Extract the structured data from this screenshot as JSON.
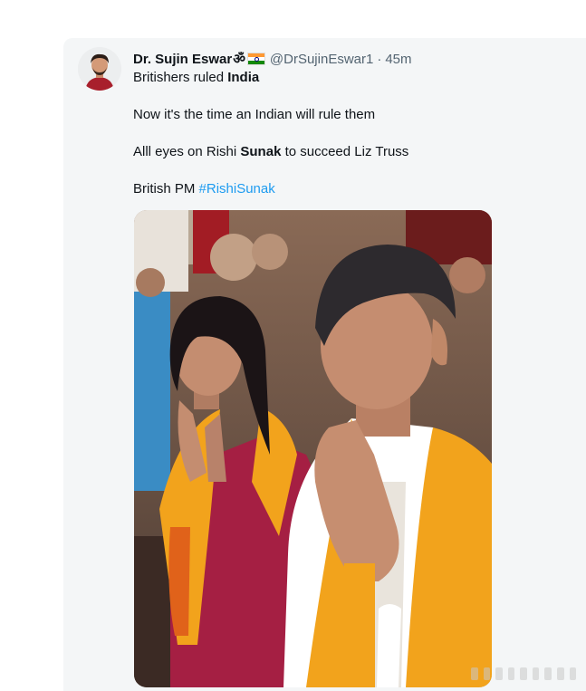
{
  "tweet": {
    "author": {
      "display_name": "Dr. Sujin Eswar",
      "om_symbol": "ॐ",
      "flag_icon": "india-flag-icon",
      "handle": "@DrSujinEswar1",
      "separator": "·",
      "time": "45m"
    },
    "lines": {
      "l1_pre": "Britishers ruled ",
      "l1_bold": "India",
      "l2": "Now it's the time an Indian will rule them",
      "l3_pre": "Alll eyes on Rishi ",
      "l3_bold": "Sunak",
      "l3_post": " to succeed Liz Truss",
      "l4_pre": "British PM ",
      "l4_hashtag": "#RishiSunak"
    }
  },
  "colors": {
    "text": "#0f1419",
    "secondary": "#536471",
    "link": "#1d9bf0",
    "card_bg": "#f4f6f7",
    "saffron": "#f2a31c"
  }
}
